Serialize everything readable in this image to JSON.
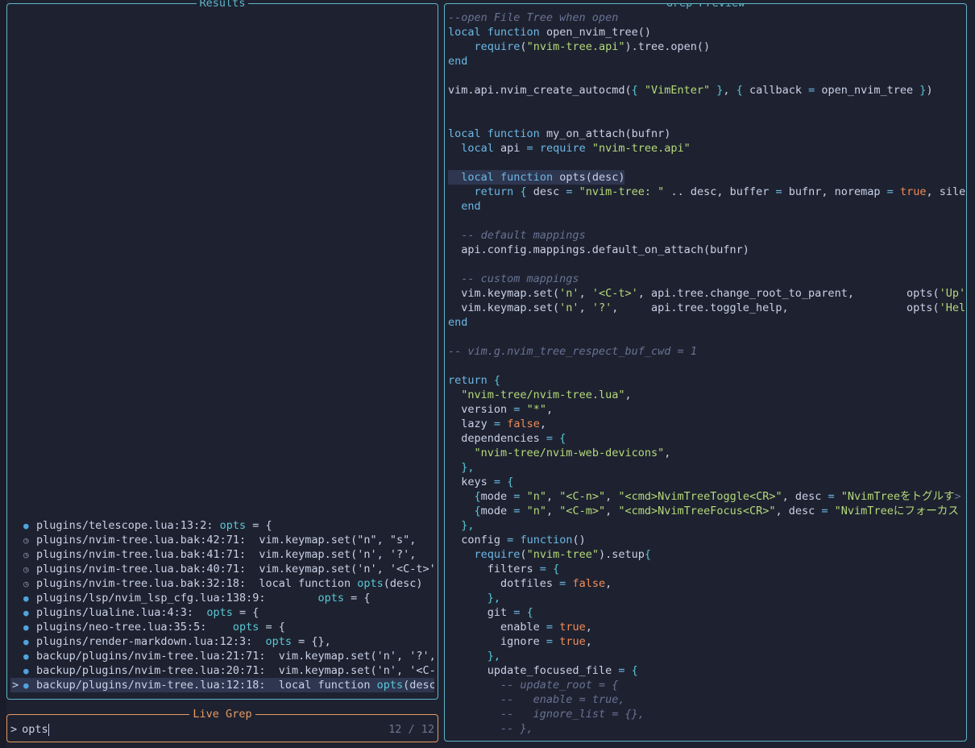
{
  "results_panel": {
    "title": "Results",
    "items": [
      {
        "icon": "lua-file-icon",
        "path": "plugins/telescope.lua:13:2: ",
        "pre": "",
        "match": "opts",
        "post": " = {"
      },
      {
        "icon": "history-icon",
        "path": "plugins/nvim-tree.lua.bak:42:71:  ",
        "pre": "vim.keymap.set(\"n\", \"s\",",
        "match": "",
        "post": ""
      },
      {
        "icon": "history-icon",
        "path": "plugins/nvim-tree.lua.bak:41:71:  ",
        "pre": "vim.keymap.set('n', '?',",
        "match": "",
        "post": ""
      },
      {
        "icon": "history-icon",
        "path": "plugins/nvim-tree.lua.bak:40:71:  ",
        "pre": "vim.keymap.set('n', '<C-t>',",
        "match": "",
        "post": ""
      },
      {
        "icon": "history-icon",
        "path": "plugins/nvim-tree.lua.bak:32:18:  ",
        "pre": "local function ",
        "match": "opts",
        "post": "(desc)"
      },
      {
        "icon": "lua-file-icon",
        "path": "plugins/lsp/nvim_lsp_cfg.lua:138:9:        ",
        "pre": "",
        "match": "opts",
        "post": " = {"
      },
      {
        "icon": "lua-file-icon",
        "path": "plugins/lualine.lua:4:3:  ",
        "pre": "",
        "match": "opts",
        "post": " = {"
      },
      {
        "icon": "lua-file-icon",
        "path": "plugins/neo-tree.lua:35:5:    ",
        "pre": "",
        "match": "opts",
        "post": " = {"
      },
      {
        "icon": "lua-file-icon",
        "path": "plugins/render-markdown.lua:12:3:  ",
        "pre": "",
        "match": "opts",
        "post": " = {},"
      },
      {
        "icon": "lua-file-icon",
        "path": "backup/plugins/nvim-tree.lua:21:71:  ",
        "pre": "vim.keymap.set('n', '?',",
        "match": "",
        "post": ""
      },
      {
        "icon": "lua-file-icon",
        "path": "backup/plugins/nvim-tree.lua:20:71:  ",
        "pre": "vim.keymap.set('n', '<C-t",
        "match": "",
        "post": ""
      },
      {
        "icon": "lua-file-icon",
        "path": "backup/plugins/nvim-tree.lua:12:18:  ",
        "pre": "local function ",
        "match": "opts",
        "post": "(desc)",
        "selected": true
      }
    ]
  },
  "preview_panel": {
    "title": "Grep Preview",
    "lines": [
      [
        [
          "cm",
          "--open File Tree when open"
        ]
      ],
      [
        [
          "kw",
          "local"
        ],
        [
          "t",
          " "
        ],
        [
          "kw",
          "function"
        ],
        [
          "t",
          " open_nvim_tree()"
        ]
      ],
      [
        [
          "t",
          "    "
        ],
        [
          "kw",
          "require"
        ],
        [
          "t",
          "("
        ],
        [
          "str",
          "\"nvim-tree.api\""
        ],
        [
          "t",
          ").tree.open()"
        ]
      ],
      [
        [
          "kw",
          "end"
        ]
      ],
      [
        [
          "t",
          ""
        ]
      ],
      [
        [
          "t",
          "vim.api.nvim_create_autocmd("
        ],
        [
          "br",
          "{"
        ],
        [
          "t",
          " "
        ],
        [
          "str",
          "\"VimEnter\""
        ],
        [
          "t",
          " "
        ],
        [
          "br",
          "}"
        ],
        [
          "t",
          ", "
        ],
        [
          "br",
          "{"
        ],
        [
          "t",
          " callback "
        ],
        [
          "op",
          "="
        ],
        [
          "t",
          " open_nvim_tree "
        ],
        [
          "br",
          "}"
        ],
        [
          "t",
          ")"
        ]
      ],
      [
        [
          "t",
          ""
        ]
      ],
      [
        [
          "t",
          ""
        ]
      ],
      [
        [
          "kw",
          "local"
        ],
        [
          "t",
          " "
        ],
        [
          "kw",
          "function"
        ],
        [
          "t",
          " my_on_attach(bufnr)"
        ]
      ],
      [
        [
          "t",
          "  "
        ],
        [
          "kw",
          "local"
        ],
        [
          "t",
          " api "
        ],
        [
          "op",
          "="
        ],
        [
          "t",
          " "
        ],
        [
          "kw",
          "require"
        ],
        [
          "t",
          " "
        ],
        [
          "str",
          "\"nvim-tree.api\""
        ]
      ],
      [
        [
          "t",
          ""
        ]
      ],
      [
        [
          "hl",
          ""
        ],
        [
          "t",
          "  "
        ],
        [
          "kw",
          "local"
        ],
        [
          "t",
          " "
        ],
        [
          "kw",
          "function"
        ],
        [
          "t",
          " opts(desc)"
        ]
      ],
      [
        [
          "t",
          "    "
        ],
        [
          "kw",
          "return"
        ],
        [
          "t",
          " "
        ],
        [
          "br",
          "{"
        ],
        [
          "t",
          " desc "
        ],
        [
          "op",
          "="
        ],
        [
          "t",
          " "
        ],
        [
          "str",
          "\"nvim-tree: \""
        ],
        [
          "t",
          " .. desc, buffer "
        ],
        [
          "op",
          "="
        ],
        [
          "t",
          " bufnr, noremap "
        ],
        [
          "op",
          "="
        ],
        [
          "t",
          " "
        ],
        [
          "bool",
          "true"
        ],
        [
          "t",
          ", silen"
        ]
      ],
      [
        [
          "t",
          "  "
        ],
        [
          "kw",
          "end"
        ]
      ],
      [
        [
          "t",
          ""
        ]
      ],
      [
        [
          "t",
          "  "
        ],
        [
          "cm",
          "-- default mappings"
        ]
      ],
      [
        [
          "t",
          "  api.config.mappings.default_on_attach(bufnr)"
        ]
      ],
      [
        [
          "t",
          ""
        ]
      ],
      [
        [
          "t",
          "  "
        ],
        [
          "cm",
          "-- custom mappings"
        ]
      ],
      [
        [
          "t",
          "  vim.keymap.set("
        ],
        [
          "str",
          "'n'"
        ],
        [
          "t",
          ", "
        ],
        [
          "str",
          "'<C-t>'"
        ],
        [
          "t",
          ", api.tree.change_root_to_parent,        opts("
        ],
        [
          "str",
          "'Up'"
        ],
        [
          "t",
          ")"
        ]
      ],
      [
        [
          "t",
          "  vim.keymap.set("
        ],
        [
          "str",
          "'n'"
        ],
        [
          "t",
          ", "
        ],
        [
          "str",
          "'?'"
        ],
        [
          "t",
          ",     api.tree.toggle_help,                  opts("
        ],
        [
          "str",
          "'Help"
        ]
      ],
      [
        [
          "kw",
          "end"
        ]
      ],
      [
        [
          "t",
          ""
        ]
      ],
      [
        [
          "cm",
          "-- vim.g.nvim_tree_respect_buf_cwd = 1"
        ]
      ],
      [
        [
          "t",
          ""
        ]
      ],
      [
        [
          "kw",
          "return"
        ],
        [
          "t",
          " "
        ],
        [
          "br",
          "{"
        ]
      ],
      [
        [
          "t",
          "  "
        ],
        [
          "str",
          "\"nvim-tree/nvim-tree.lua\""
        ],
        [
          "t",
          ","
        ]
      ],
      [
        [
          "t",
          "  version "
        ],
        [
          "op",
          "="
        ],
        [
          "t",
          " "
        ],
        [
          "str",
          "\"*\""
        ],
        [
          "t",
          ","
        ]
      ],
      [
        [
          "t",
          "  lazy "
        ],
        [
          "op",
          "="
        ],
        [
          "t",
          " "
        ],
        [
          "bool",
          "false"
        ],
        [
          "t",
          ","
        ]
      ],
      [
        [
          "t",
          "  dependencies "
        ],
        [
          "op",
          "="
        ],
        [
          "t",
          " "
        ],
        [
          "br",
          "{"
        ]
      ],
      [
        [
          "t",
          "    "
        ],
        [
          "str",
          "\"nvim-tree/nvim-web-devicons\""
        ],
        [
          "t",
          ","
        ]
      ],
      [
        [
          "t",
          "  "
        ],
        [
          "br",
          "},"
        ]
      ],
      [
        [
          "t",
          "  keys "
        ],
        [
          "op",
          "="
        ],
        [
          "t",
          " "
        ],
        [
          "br",
          "{"
        ]
      ],
      [
        [
          "t",
          "    "
        ],
        [
          "br",
          "{"
        ],
        [
          "t",
          "mode "
        ],
        [
          "op",
          "="
        ],
        [
          "t",
          " "
        ],
        [
          "str",
          "\"n\""
        ],
        [
          "t",
          ", "
        ],
        [
          "str",
          "\"<C-n>\""
        ],
        [
          "t",
          ", "
        ],
        [
          "str",
          "\"<cmd>NvimTreeToggle<CR>\""
        ],
        [
          "t",
          ", desc "
        ],
        [
          "op",
          "="
        ],
        [
          "t",
          " "
        ],
        [
          "str",
          "\"NvimTreeをトグルす"
        ],
        [
          "cm",
          ">"
        ]
      ],
      [
        [
          "t",
          "    "
        ],
        [
          "br",
          "{"
        ],
        [
          "t",
          "mode "
        ],
        [
          "op",
          "="
        ],
        [
          "t",
          " "
        ],
        [
          "str",
          "\"n\""
        ],
        [
          "t",
          ", "
        ],
        [
          "str",
          "\"<C-m>\""
        ],
        [
          "t",
          ", "
        ],
        [
          "str",
          "\"<cmd>NvimTreeFocus<CR>\""
        ],
        [
          "t",
          ", desc "
        ],
        [
          "op",
          "="
        ],
        [
          "t",
          " "
        ],
        [
          "str",
          "\"NvimTreeにフォーカス"
        ]
      ],
      [
        [
          "t",
          "  "
        ],
        [
          "br",
          "},"
        ]
      ],
      [
        [
          "t",
          "  config "
        ],
        [
          "op",
          "="
        ],
        [
          "t",
          " "
        ],
        [
          "kw",
          "function"
        ],
        [
          "t",
          "()"
        ]
      ],
      [
        [
          "t",
          "    "
        ],
        [
          "kw",
          "require"
        ],
        [
          "t",
          "("
        ],
        [
          "str",
          "\"nvim-tree\""
        ],
        [
          "t",
          ").setup"
        ],
        [
          "br",
          "{"
        ]
      ],
      [
        [
          "t",
          "      filters "
        ],
        [
          "op",
          "="
        ],
        [
          "t",
          " "
        ],
        [
          "br",
          "{"
        ]
      ],
      [
        [
          "t",
          "        dotfiles "
        ],
        [
          "op",
          "="
        ],
        [
          "t",
          " "
        ],
        [
          "bool",
          "false"
        ],
        [
          "t",
          ","
        ]
      ],
      [
        [
          "t",
          "      "
        ],
        [
          "br",
          "},"
        ]
      ],
      [
        [
          "t",
          "      git "
        ],
        [
          "op",
          "="
        ],
        [
          "t",
          " "
        ],
        [
          "br",
          "{"
        ]
      ],
      [
        [
          "t",
          "        enable "
        ],
        [
          "op",
          "="
        ],
        [
          "t",
          " "
        ],
        [
          "bool",
          "true"
        ],
        [
          "t",
          ","
        ]
      ],
      [
        [
          "t",
          "        ignore "
        ],
        [
          "op",
          "="
        ],
        [
          "t",
          " "
        ],
        [
          "bool",
          "true"
        ],
        [
          "t",
          ","
        ]
      ],
      [
        [
          "t",
          "      "
        ],
        [
          "br",
          "},"
        ]
      ],
      [
        [
          "t",
          "      update_focused_file "
        ],
        [
          "op",
          "="
        ],
        [
          "t",
          " "
        ],
        [
          "br",
          "{"
        ]
      ],
      [
        [
          "t",
          "        "
        ],
        [
          "cm",
          "-- update_root = {"
        ]
      ],
      [
        [
          "t",
          "        "
        ],
        [
          "cm",
          "--   enable = true,"
        ]
      ],
      [
        [
          "t",
          "        "
        ],
        [
          "cm",
          "--   ignore_list = {},"
        ]
      ],
      [
        [
          "t",
          "        "
        ],
        [
          "cm",
          "-- },"
        ]
      ]
    ]
  },
  "prompt_panel": {
    "title": "Live Grep",
    "prompt_char": ">",
    "query": "opts",
    "counter": "12 / 12"
  },
  "selection_caret": ">",
  "colors": {
    "background": "#1e2230",
    "border": "#5fb5c9",
    "prompt_border": "#e59b63",
    "match": "#59c7d5",
    "keyword": "#6cb8e6",
    "string": "#b5d97a",
    "boolean": "#f08c57",
    "comment": "#687294"
  }
}
